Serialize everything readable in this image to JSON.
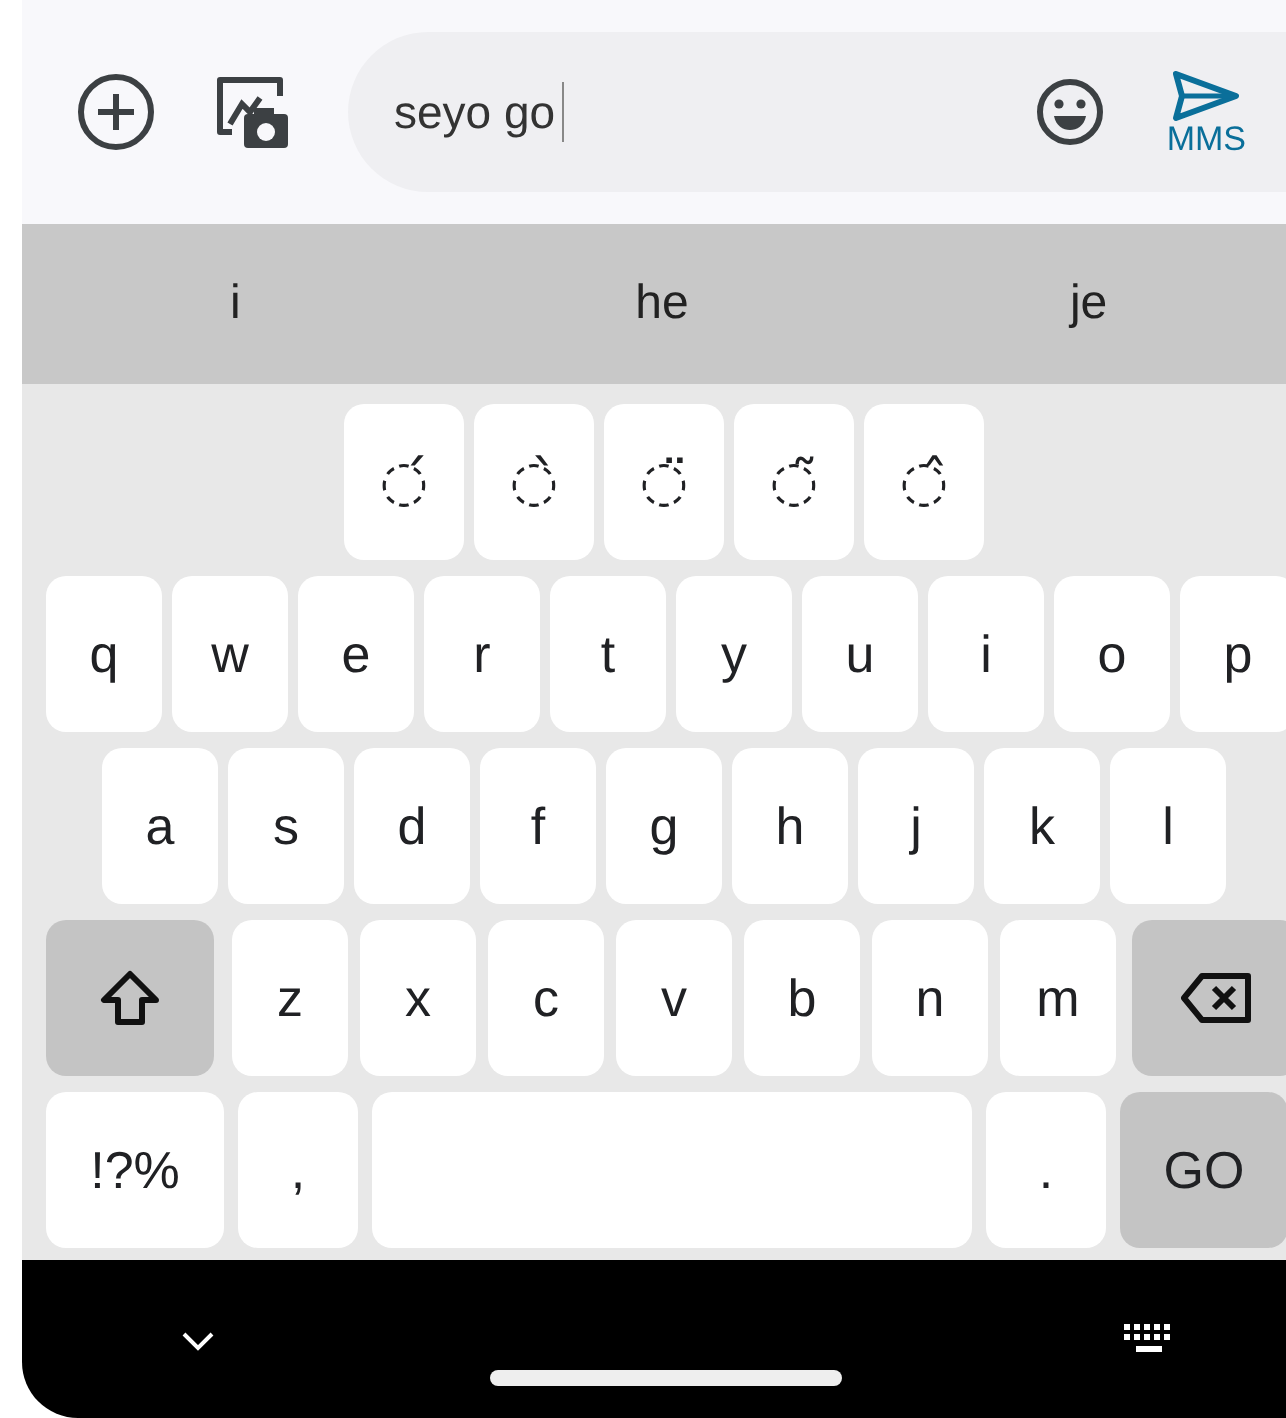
{
  "composer": {
    "message": "seyo go",
    "cursor": true,
    "send_label": "MMS"
  },
  "suggestions": [
    "i",
    "he",
    "je"
  ],
  "accents": [
    "◌́",
    "◌̀",
    "◌̈",
    "◌̃",
    "◌̂"
  ],
  "keyboard": [
    {
      "keys": [
        {
          "kind": "letter",
          "label": "q"
        },
        {
          "kind": "letter",
          "label": "w"
        },
        {
          "kind": "letter",
          "label": "e"
        },
        {
          "kind": "letter",
          "label": "r"
        },
        {
          "kind": "letter",
          "label": "t"
        },
        {
          "kind": "letter",
          "label": "y"
        },
        {
          "kind": "letter",
          "label": "u"
        },
        {
          "kind": "letter",
          "label": "i"
        },
        {
          "kind": "letter",
          "label": "o"
        },
        {
          "kind": "letter",
          "label": "p"
        }
      ]
    },
    {
      "keys": [
        {
          "kind": "letter",
          "label": "a"
        },
        {
          "kind": "letter",
          "label": "s"
        },
        {
          "kind": "letter",
          "label": "d"
        },
        {
          "kind": "letter",
          "label": "f"
        },
        {
          "kind": "letter",
          "label": "g"
        },
        {
          "kind": "letter",
          "label": "h"
        },
        {
          "kind": "letter",
          "label": "j"
        },
        {
          "kind": "letter",
          "label": "k"
        },
        {
          "kind": "letter",
          "label": "l"
        }
      ]
    },
    {
      "keys": [
        {
          "kind": "shift"
        },
        {
          "kind": "letter",
          "label": "z"
        },
        {
          "kind": "letter",
          "label": "x"
        },
        {
          "kind": "letter",
          "label": "c"
        },
        {
          "kind": "letter",
          "label": "v"
        },
        {
          "kind": "letter",
          "label": "b"
        },
        {
          "kind": "letter",
          "label": "n"
        },
        {
          "kind": "letter",
          "label": "m"
        },
        {
          "kind": "backspace"
        }
      ]
    },
    {
      "keys": [
        {
          "kind": "symbols",
          "label": "!?%"
        },
        {
          "kind": "punct",
          "label": ","
        },
        {
          "kind": "space"
        },
        {
          "kind": "punct",
          "label": "."
        },
        {
          "kind": "action",
          "label": "GO"
        }
      ]
    }
  ]
}
